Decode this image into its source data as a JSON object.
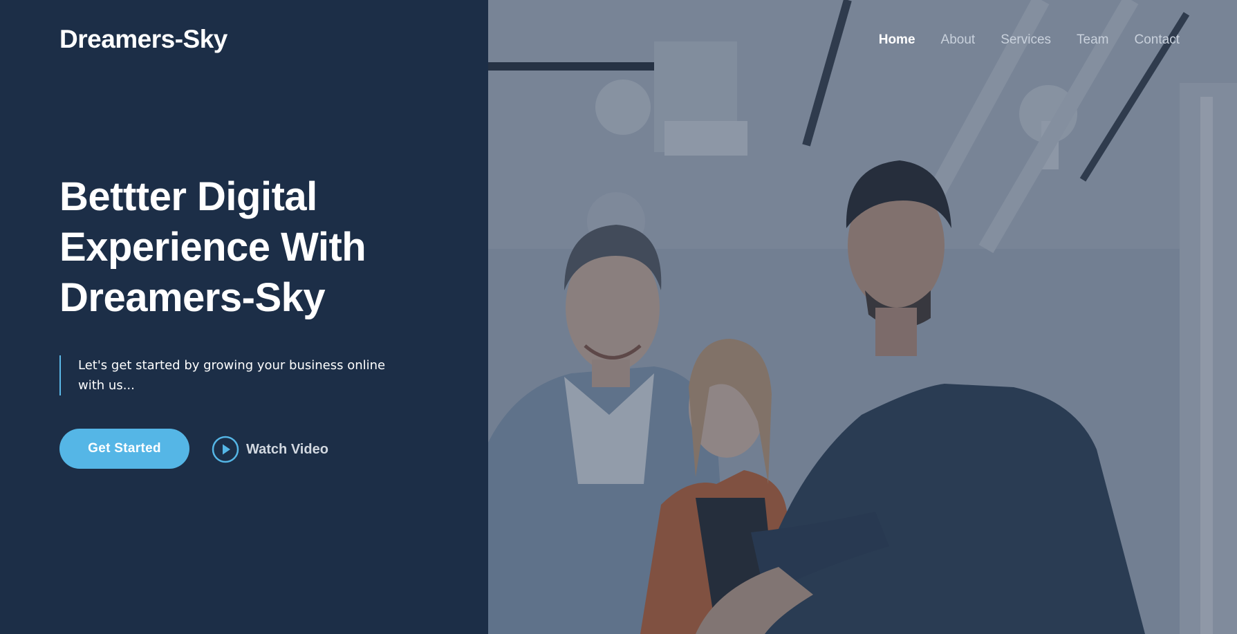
{
  "brand": {
    "name": "Dreamers-Sky"
  },
  "nav": {
    "items": [
      {
        "label": "Home",
        "active": true
      },
      {
        "label": "About",
        "active": false
      },
      {
        "label": "Services",
        "active": false
      },
      {
        "label": "Team",
        "active": false
      },
      {
        "label": "Contact",
        "active": false
      }
    ]
  },
  "hero": {
    "headline_lines": [
      "Bettter Digital",
      "Experience With",
      "Dreamers-Sky"
    ],
    "tagline": "Let's get started by growing your business online with us...",
    "cta_label": "Get Started",
    "video_label": "Watch Video",
    "video_icon": "play-circle-icon",
    "image_subject": "three-colleagues-team-photo"
  },
  "colors": {
    "panel_bg": "#1c2e47",
    "accent": "#55b6e6",
    "text_primary": "#ffffff",
    "text_muted": "#c9d1dc"
  }
}
